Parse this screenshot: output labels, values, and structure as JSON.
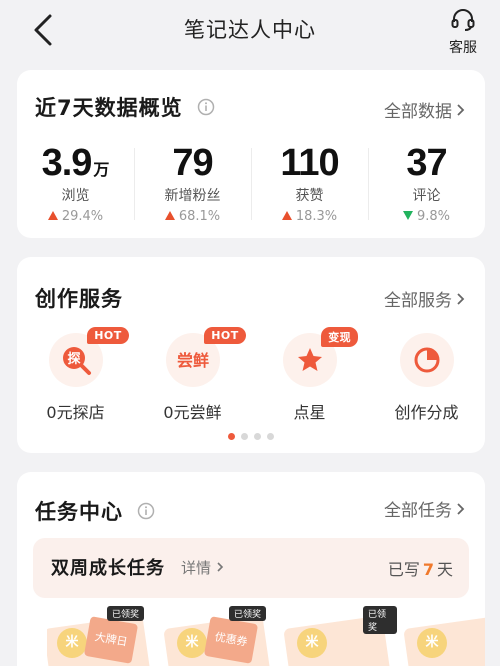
{
  "header": {
    "title": "笔记达人中心",
    "service_label": "客服"
  },
  "overview": {
    "title": "近7天数据概览",
    "more_label": "全部数据",
    "stats": [
      {
        "value": "3.9",
        "unit": "万",
        "label": "浏览",
        "delta": "29.4%",
        "direction": "up"
      },
      {
        "value": "79",
        "unit": "",
        "label": "新增粉丝",
        "delta": "68.1%",
        "direction": "up"
      },
      {
        "value": "110",
        "unit": "",
        "label": "获赞",
        "delta": "18.3%",
        "direction": "up"
      },
      {
        "value": "37",
        "unit": "",
        "label": "评论",
        "delta": "9.8%",
        "direction": "down"
      }
    ]
  },
  "services": {
    "title": "创作服务",
    "more_label": "全部服务",
    "items": [
      {
        "label": "0元探店",
        "badge": "HOT",
        "icon": "explore-store-icon"
      },
      {
        "label": "0元尝鲜",
        "badge": "HOT",
        "icon": "try-fresh-icon"
      },
      {
        "label": "点星",
        "badge": "变现",
        "icon": "star-icon"
      },
      {
        "label": "创作分成",
        "badge": "",
        "icon": "pie-chart-icon"
      }
    ],
    "page_count": 4,
    "active_page": 0,
    "icon_glyphs": {
      "explore": "探",
      "fresh": "尝鲜"
    }
  },
  "tasks": {
    "title": "任务中心",
    "more_label": "全部任务",
    "banner_title": "双周成长任务",
    "detail_label": "详情",
    "written_prefix": "已写",
    "written_days": "7",
    "written_suffix": "天",
    "rewards": [
      {
        "tag": "已领奖",
        "text": "大牌日"
      },
      {
        "tag": "已领奖",
        "text": "优惠券"
      },
      {
        "tag": "已领奖",
        "text": ""
      },
      {
        "tag": "",
        "text": ""
      }
    ]
  },
  "colors": {
    "accent": "#ee5a3c",
    "up": "#e8502d",
    "down": "#22b35e",
    "days": "#f0792b"
  }
}
